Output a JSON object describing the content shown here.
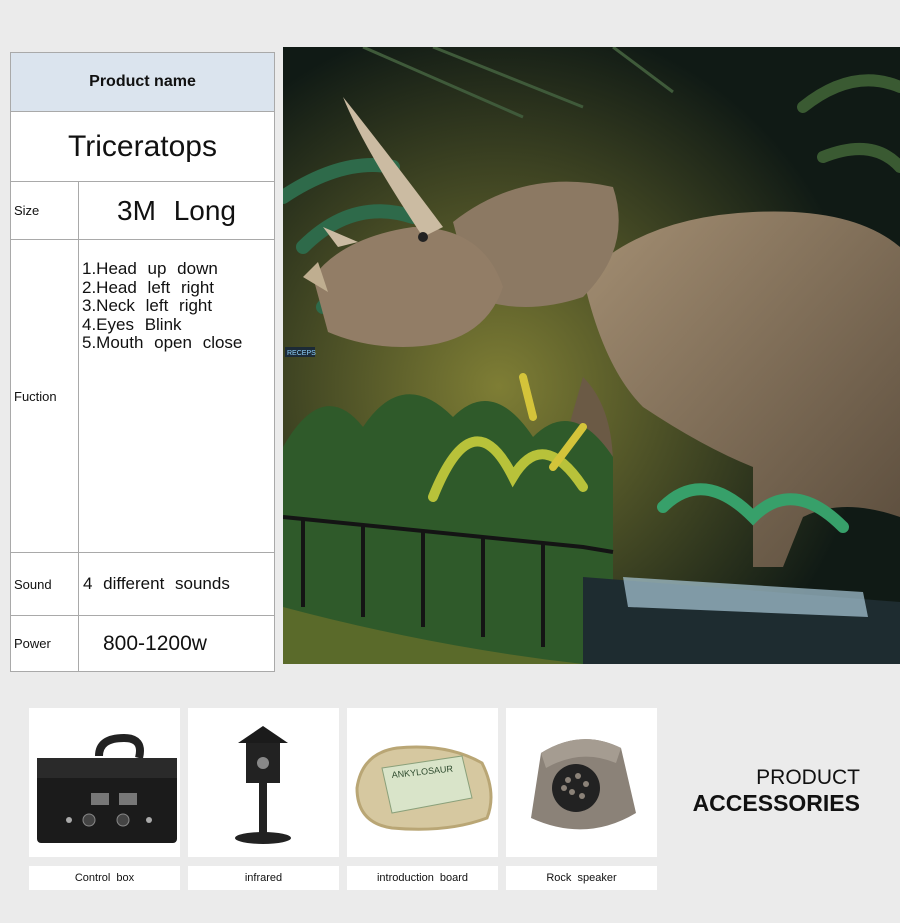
{
  "spec": {
    "header": "Product  name",
    "product_name": "Triceratops",
    "rows": [
      {
        "label": "Size",
        "value": "3M  Long"
      },
      {
        "label": "Fuction",
        "items": [
          "1.Head  up  down",
          "2.Head  left  right",
          "3.Neck  left  right",
          "4.Eyes  Blink",
          "5.Mouth  open  close"
        ]
      },
      {
        "label": "Sound",
        "value": "4  different  sounds"
      },
      {
        "label": "Power",
        "value": "800-1200w"
      }
    ]
  },
  "hero": {
    "sign_text": "RECEPS"
  },
  "accessories": {
    "title_line1": "PRODUCT",
    "title_line2": "ACCESSORIES",
    "items": [
      {
        "label": "Control  box",
        "icon": "control-box-icon"
      },
      {
        "label": "infrared",
        "icon": "infrared-sensor-icon"
      },
      {
        "label": "introduction  board",
        "icon": "introduction-board-icon",
        "board_text": "ANKYLOSAUR"
      },
      {
        "label": "Rock  speaker",
        "icon": "rock-speaker-icon"
      }
    ]
  },
  "colors": {
    "header_bg": "#dbe4ee",
    "border": "#a9a9a9",
    "page_bg": "#ebebeb"
  }
}
